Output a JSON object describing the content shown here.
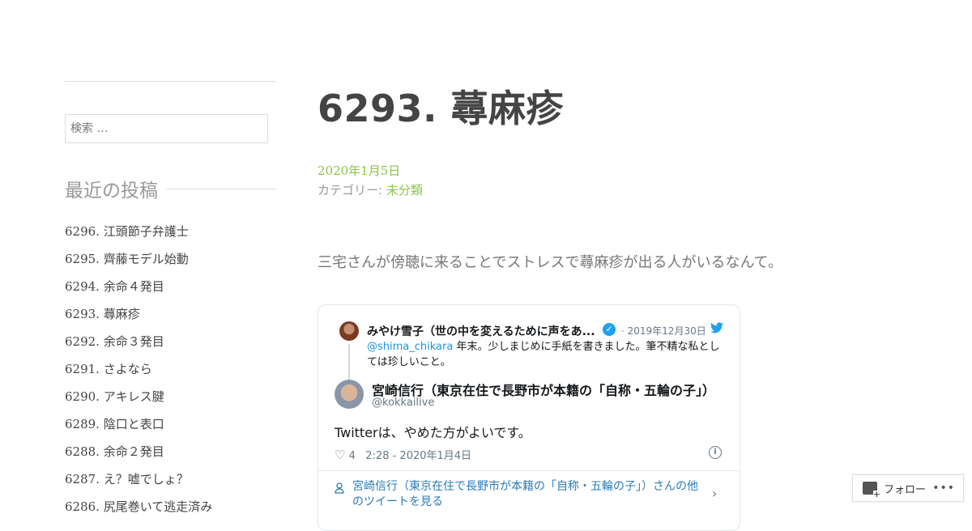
{
  "sidebar": {
    "search_placeholder": "検索 …",
    "recent_heading": "最近の投稿",
    "recent_posts": [
      "6296. 江頭節子弁護士",
      "6295. 齊藤モデル始動",
      "6294. 余命４発目",
      "6293. 蕁麻疹",
      "6292. 余命３発目",
      "6291. さよなら",
      "6290. アキレス腱",
      "6289. 陰口と表口",
      "6288. 余命２発目",
      "6287. え？嘘でしょ？",
      "6286. 尻尾巻いて逃走済み"
    ]
  },
  "post": {
    "title": "6293. 蕁麻疹",
    "date": "2020年1月5日",
    "category_label": "カテゴリー:",
    "category": "未分類",
    "lead": "三宅さんが傍聴に来ることでストレスで蕁麻疹が出る人がいるなんて。"
  },
  "tweet": {
    "parent_name": "みやけ雪子（世の中を変えるために声をあ...",
    "parent_date": "· 2019年12月30日",
    "parent_mention": "@shima_chikara",
    "parent_text": " 年末。少しまじめに手紙を書きました。筆不精な私としては珍しいこと。",
    "author_name": "宮崎信行（東京在住で長野市が本籍の「自称・五輪の子」）",
    "author_handle": "@kokkailive",
    "text": "Twitterは、やめた方がよいです。",
    "likes": "4",
    "timestamp": "2:28 - 2020年1月4日",
    "more_text": "宮崎信行（東京在住で長野市が本籍の「自称・五輪の子」）さんの他のツイートを見る",
    "icons": [
      "verified-badge-icon",
      "twitter-bird-icon",
      "heart-icon",
      "info-icon",
      "person-icon",
      "chevron-right-icon"
    ]
  },
  "follow": {
    "label": "フォロー",
    "dots": "•••"
  }
}
